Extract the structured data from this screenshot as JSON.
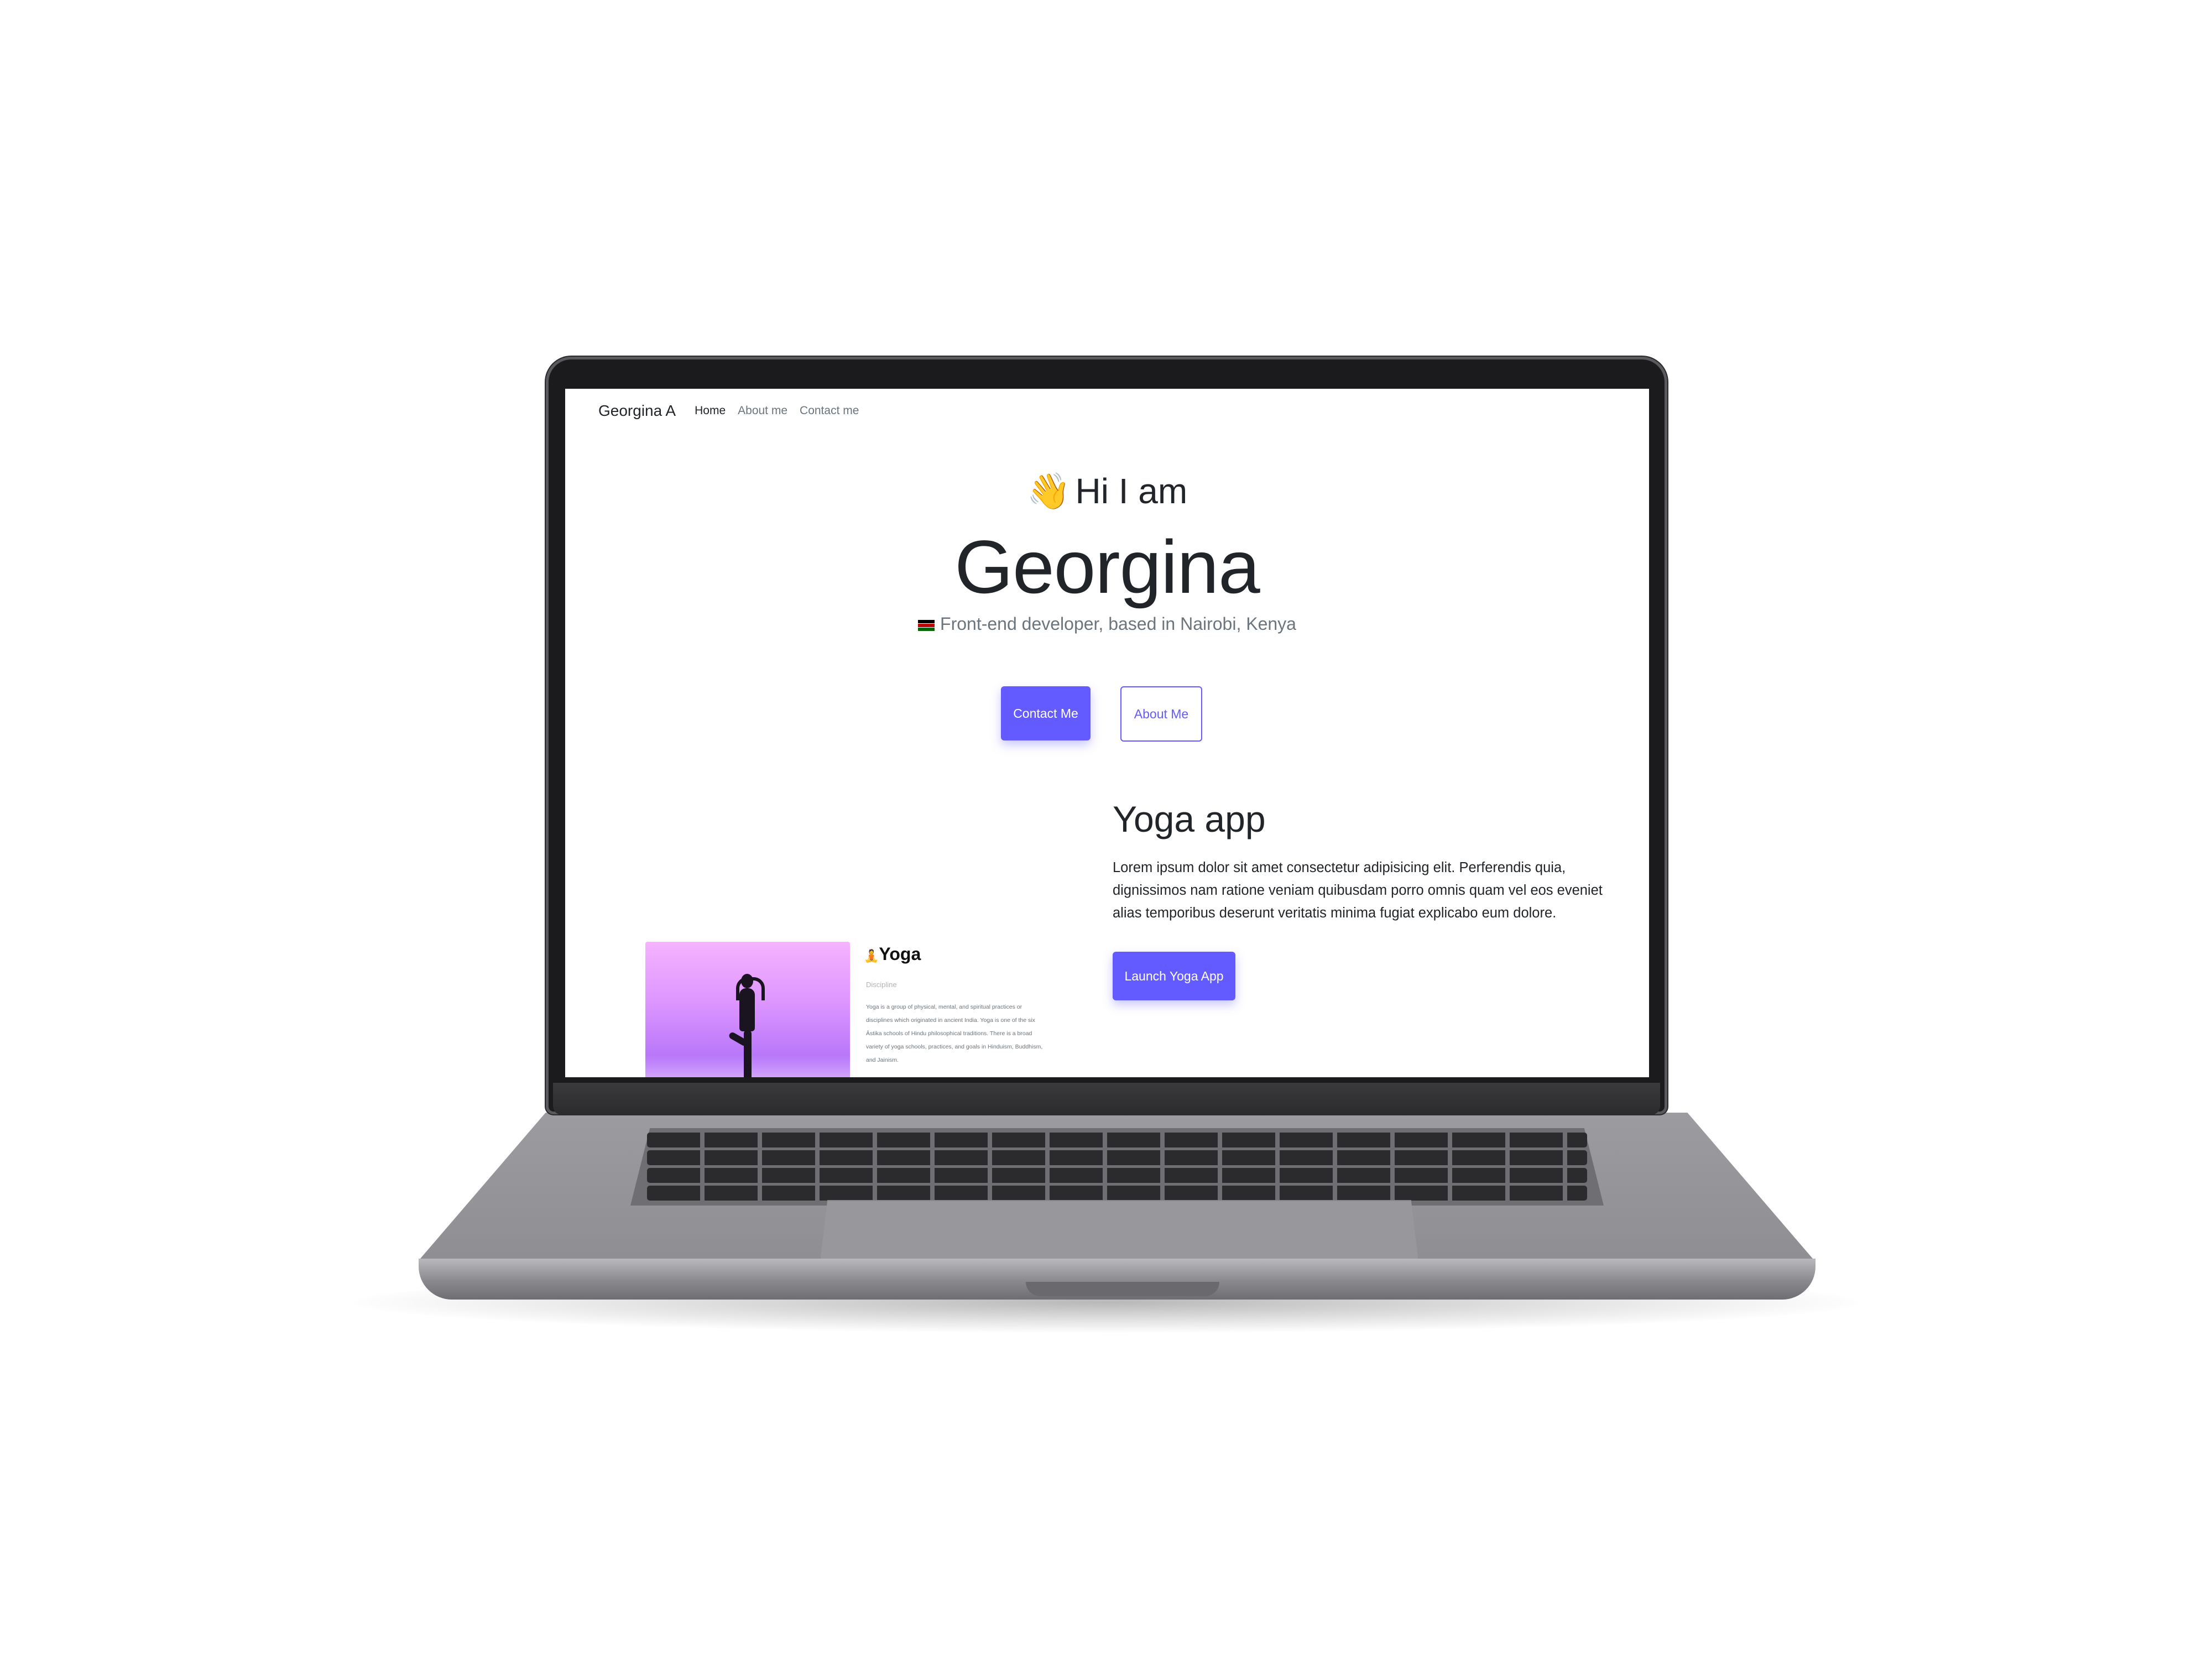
{
  "navbar": {
    "brand": "Georgina A",
    "links": [
      {
        "label": "Home",
        "active": true
      },
      {
        "label": "About me",
        "active": false
      },
      {
        "label": "Contact me",
        "active": false
      }
    ]
  },
  "hero": {
    "greeting_emoji": "👋",
    "greeting": "Hi I am",
    "name": "Georgina",
    "subtitle_icon": "kenya-flag",
    "subtitle": "Front-end developer, based in Nairobi, Kenya",
    "buttons": {
      "contact": "Contact Me",
      "about": "About Me"
    }
  },
  "project": {
    "title": "Yoga app",
    "description": "Lorem ipsum dolor sit amet consectetur adipisicing elit. Perferendis quia, dignissimos nam ratione veniam quibusdam porro omnis quam vel eos eveniet alias temporibus deserunt veritatis minima fugiat explicabo eum dolore.",
    "launch_label": "Launch Yoga App",
    "preview": {
      "emoji": "🧘",
      "title": "Yoga",
      "subtitle": "Discipline",
      "text": "Yoga is a group of physical, mental, and spiritual practices or disciplines which originated in ancient India. Yoga is one of the six Āstika schools of Hindu philosophical traditions. There is a broad variety of yoga schools, practices, and goals in Hinduism, Buddhism, and Jainism."
    }
  },
  "colors": {
    "accent": "#635bff",
    "text": "#212529",
    "muted": "#6c757d",
    "laptop_bezel": "#1b1b1d",
    "laptop_body": "#929296"
  }
}
